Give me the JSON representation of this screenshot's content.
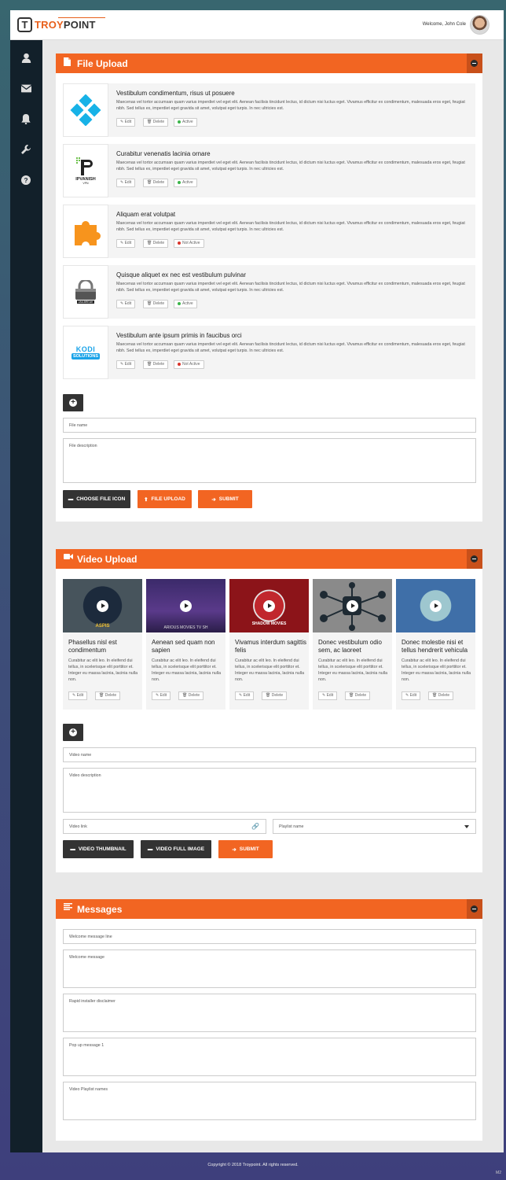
{
  "header": {
    "brand_a": "TROY",
    "brand_b": "POINT",
    "welcome": "Welcome, John Cole"
  },
  "sidebar": {
    "icons": [
      "user-icon",
      "envelope-icon",
      "bell-icon",
      "wrench-icon",
      "question-icon"
    ]
  },
  "file_upload": {
    "title": "File Upload",
    "items": [
      {
        "title": "Vestibulum condimentum, risus ut posuere",
        "desc": "Maecenas vel tortor accumsan quam varius imperdiet vel eget elit. Aenean facilisis tincidunt lectus, id dictum nisi luctus eget. Vivamus efficitur ex condimentum, malesuada eros eget, feugiat nibh. Sed tellus ex, imperdiet eget gravida sit amet, volutpat eget turpis. In nec ultricies est.",
        "status": "Active"
      },
      {
        "title": "Curabitur venenatis lacinia ornare",
        "desc": "Maecenas vel tortor accumsan quam varius imperdiet vel eget elit. Aenean facilisis tincidunt lectus, id dictum nisi luctus eget. Vivamus efficitur ex condimentum, malesuada eros eget, feugiat nibh. Sed tellus ex, imperdiet eget gravida sit amet, volutpat eget turpis. In nec ultricies est.",
        "status": "Active"
      },
      {
        "title": "Aliquam erat volutpat",
        "desc": "Maecenas vel tortor accumsan quam varius imperdiet vel eget elit. Aenean facilisis tincidunt lectus, id dictum nisi luctus eget. Vivamus efficitur ex condimentum, malesuada eros eget, feugiat nibh. Sed tellus ex, imperdiet eget gravida sit amet, volutpat eget turpis. In nec ultricies est.",
        "status": "Not Active"
      },
      {
        "title": "Quisque aliquet ex nec est vestibulum pulvinar",
        "desc": "Maecenas vel tortor accumsan quam varius imperdiet vel eget elit. Aenean facilisis tincidunt lectus, id dictum nisi luctus eget. Vivamus efficitur ex condimentum, malesuada eros eget, feugiat nibh. Sed tellus ex, imperdiet eget gravida sit amet, volutpat eget turpis. In nec ultricies est.",
        "status": "Active"
      },
      {
        "title": "Vestibulum ante ipsum primis in faucibus orci",
        "desc": "Maecenas vel tortor accumsan quam varius imperdiet vel eget elit. Aenean facilisis tincidunt lectus, id dictum nisi luctus eget. Vivamus efficitur ex condimentum, malesuada eros eget, feugiat nibh. Sed tellus ex, imperdiet eget gravida sit amet, volutpat eget turpis. In nec ultricies est.",
        "status": "Not Active"
      }
    ],
    "edit_label": "Edit",
    "delete_label": "Delete",
    "file_name_placeholder": "File name",
    "file_desc_placeholder": "File description",
    "choose_icon_label": "CHOOSE FILE ICON",
    "file_upload_label": "FILE UPLOAD",
    "submit_label": "SUBMIT",
    "logo_texts": [
      "IPVANISH",
      "VPN",
      "JAILBREAK",
      "KODI",
      "SOLUTIONS"
    ]
  },
  "video_upload": {
    "title": "Video Upload",
    "videos": [
      {
        "title": "Phasellus nisl est condimentum",
        "desc": "Curabitur ac elit leo. In eleifend dui tellus, in scelerisque elit porttitor et. Integer eu massa lacinia, lacinia nulla non.",
        "thumb_text": "ASPIS"
      },
      {
        "title": "Aenean sed quam non sapien",
        "desc": "Curabitur ac elit leo. In eleifend dui tellus, in scelerisque elit porttitor et. Integer eu massa lacinia, lacinia nulla non.",
        "thumb_text": "ARIOUS   MOVIES   TV SH"
      },
      {
        "title": "Vivamus interdum sagittis felis",
        "desc": "Curabitur ac elit leo. In eleifend dui tellus, in scelerisque elit porttitor et. Integer eu massa lacinia, lacinia nulla non.",
        "thumb_text": "SHADOW MOVIES"
      },
      {
        "title": "Donec vestibulum odio sem, ac laoreet",
        "desc": "Curabitur ac elit leo. In eleifend dui tellus, in scelerisque elit porttitor et. Integer eu massa lacinia, lacinia nulla non.",
        "thumb_text": ""
      },
      {
        "title": "Donec molestie nisi et tellus hendrerit vehicula",
        "desc": "Curabitur ac elit leo. In eleifend dui tellus, in scelerisque elit porttitor et. Integer eu massa lacinia, lacinia nulla non.",
        "thumb_text": ""
      }
    ],
    "edit_label": "Edit",
    "delete_label": "Delete",
    "video_name_placeholder": "Video name",
    "video_desc_placeholder": "Video description",
    "video_link_placeholder": "Video link",
    "playlist_placeholder": "Playlist name",
    "thumbnail_label": "VIDEO THUMBNAIL",
    "full_image_label": "VIDEO FULL IMAGE",
    "submit_label": "SUBMIT"
  },
  "messages": {
    "title": "Messages",
    "welcome_line": "Welcome message line",
    "welcome_message": "Welcome message",
    "disclaimer": "Rapid installer disclaimer",
    "popup": "Pop up message 1",
    "playlist_names": "Video Playlist names"
  },
  "footer": {
    "copyright": "Copyright  ©  2018  Troypoint.   All rights reserved.",
    "version": "M2"
  },
  "colors": {
    "accent": "#f26522",
    "dark": "#333333",
    "sidebar": "#12202a",
    "active": "#3cb54a",
    "inactive": "#d9342b"
  }
}
